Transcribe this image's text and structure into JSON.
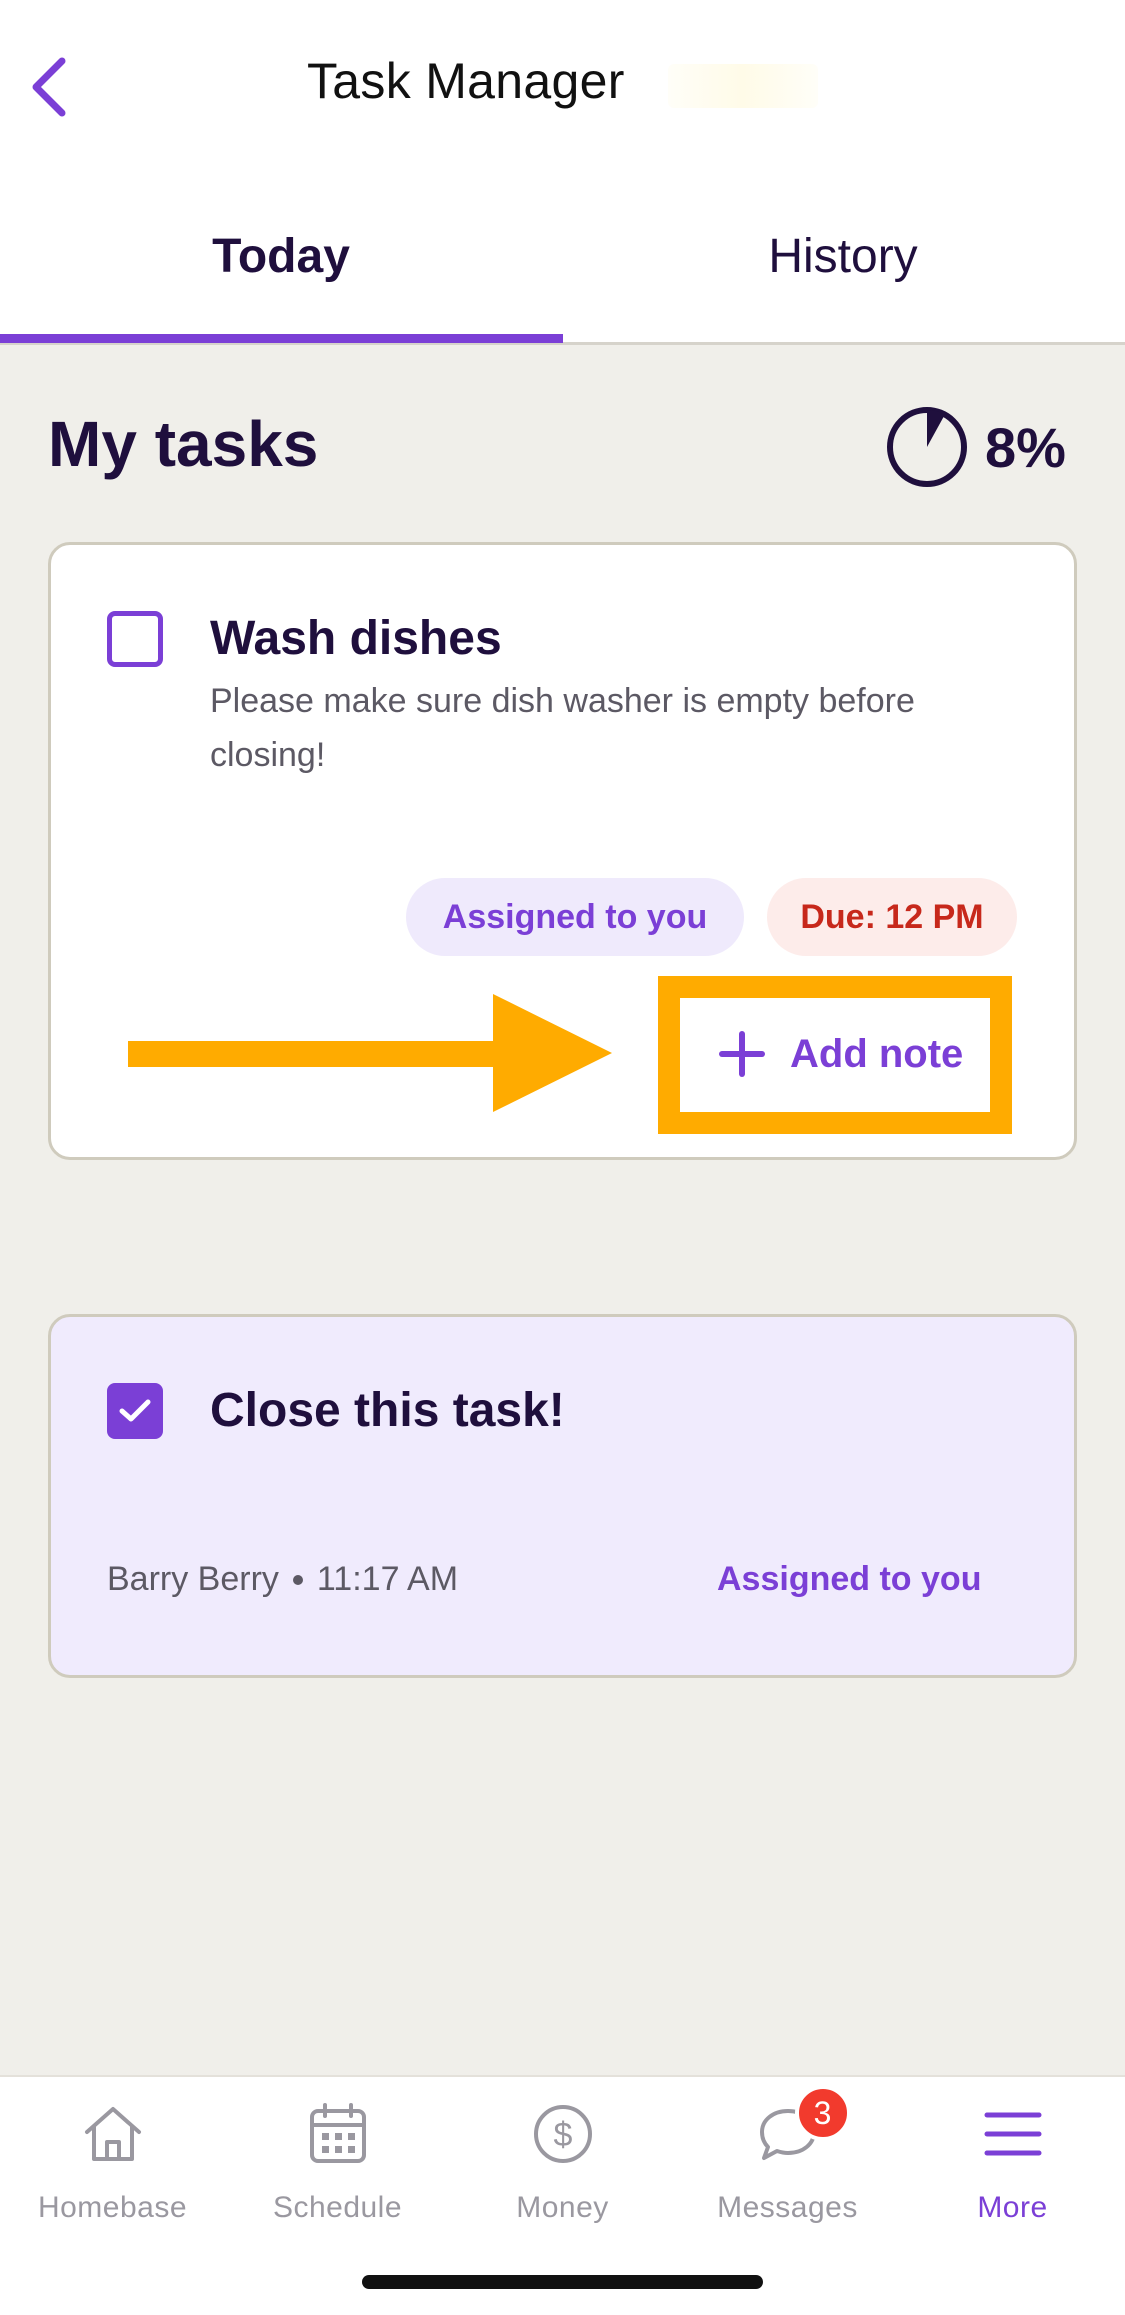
{
  "header": {
    "title": "Task Manager",
    "back_icon": "chevron-left-icon"
  },
  "tabs": [
    {
      "label": "Today",
      "active": true
    },
    {
      "label": "History",
      "active": false
    }
  ],
  "section": {
    "title": "My tasks",
    "progress_percent": 8,
    "progress_label": "8%"
  },
  "tasks": [
    {
      "title": "Wash dishes",
      "description": "Please make sure dish washer is empty before closing!",
      "completed": false,
      "assigned_label": "Assigned to you",
      "due_label": "Due: 12 PM",
      "add_note_label": "Add note"
    },
    {
      "title": "Close this task!",
      "completed": true,
      "completed_by": "Barry Berry",
      "completed_time": "11:17 AM",
      "assigned_label": "Assigned to you"
    }
  ],
  "nav": {
    "items": [
      {
        "label": "Homebase",
        "icon": "home-icon",
        "active": false
      },
      {
        "label": "Schedule",
        "icon": "calendar-icon",
        "active": false
      },
      {
        "label": "Money",
        "icon": "dollar-icon",
        "active": false
      },
      {
        "label": "Messages",
        "icon": "chat-icon",
        "active": false,
        "badge": "3"
      },
      {
        "label": "More",
        "icon": "menu-icon",
        "active": true
      }
    ]
  },
  "colors": {
    "accent": "#7b3fd6",
    "highlight": "#ffab00",
    "due": "#c7281b",
    "background": "#f0efea"
  }
}
